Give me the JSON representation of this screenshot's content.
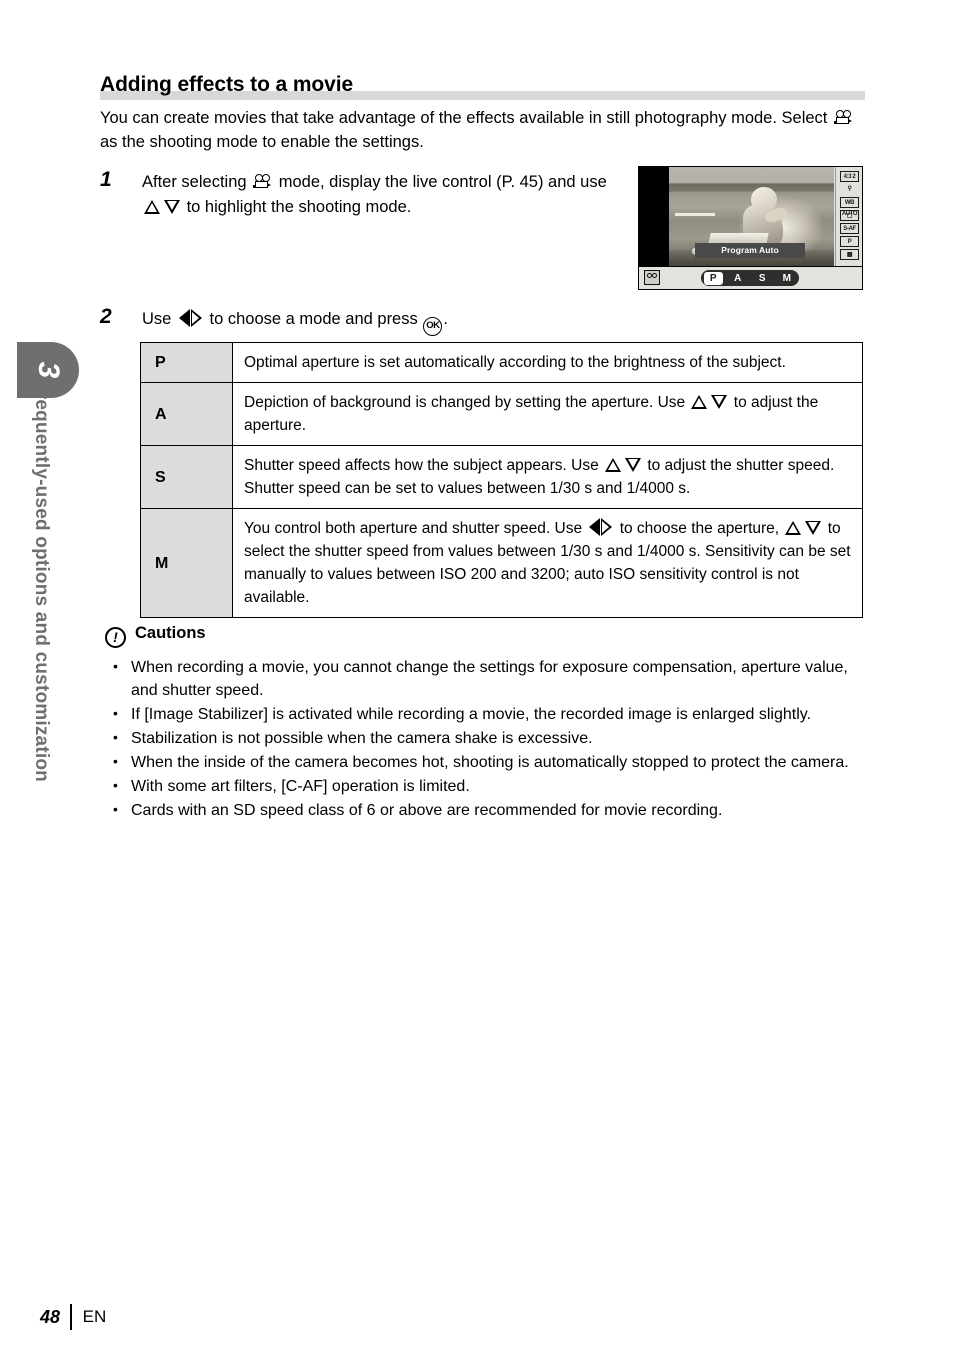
{
  "chapter": {
    "number": "3",
    "title": "Frequently-used options and customization"
  },
  "section": {
    "heading": "Adding effects to a movie",
    "intro_part1": "You can create movies that take advantage of the effects available in still photography mode. Select ",
    "intro_part2": " as the shooting mode to enable the settings."
  },
  "steps": [
    {
      "number": "1",
      "text_a": "After selecting ",
      "text_b": " mode, display the live control (P. 45) and use ",
      "text_c": " to highlight the shooting mode."
    },
    {
      "number": "2",
      "text_a": "Use ",
      "text_b": " to choose a mode and press ",
      "text_c": "."
    }
  ],
  "lcd": {
    "mode_label": "Program Auto",
    "mode_strip": [
      {
        "label": "P",
        "selected": true
      },
      {
        "label": "A",
        "selected": false
      },
      {
        "label": "S",
        "selected": false
      },
      {
        "label": "M",
        "selected": false
      }
    ],
    "side_icons": [
      {
        "name": "image-aspect-icon",
        "label": "4:3 2"
      },
      {
        "name": "art-filter-icon",
        "label": ""
      },
      {
        "name": "white-balance-auto-icon",
        "label": "WB AUTO"
      },
      {
        "name": "drive-mode-icon",
        "label": ""
      },
      {
        "name": "af-mode-icon",
        "label": "S-AF"
      },
      {
        "name": "shooting-mode-icon",
        "label": "P"
      },
      {
        "name": "image-quality-icon",
        "label": ""
      }
    ]
  },
  "mode_table": {
    "rows": [
      {
        "key": "P",
        "desc": "Optimal aperture is set automatically according to the brightness of the subject."
      },
      {
        "key": "A",
        "desc_a": "Depiction of background is changed by setting the aperture. Use ",
        "desc_b": " to adjust the aperture."
      },
      {
        "key": "S",
        "desc_a": "Shutter speed affects how the subject appears. Use ",
        "desc_b": " to adjust the shutter speed. Shutter speed can be set to values between 1/30 s and 1/4000 s."
      },
      {
        "key": "M",
        "desc_a": "You control both aperture and shutter speed. Use ",
        "desc_b": " to choose the aperture, ",
        "desc_c": " to select the shutter speed from values between 1/30 s and 1/4000 s. Sensitivity can be set manually to values between ISO 200 and 3200; auto ISO sensitivity control is not available."
      }
    ]
  },
  "cautions": {
    "heading": "Cautions",
    "items": [
      "When recording a movie, you cannot change the settings for exposure compensation, aperture value, and shutter speed.",
      "If [Image Stabilizer] is activated while recording a movie, the recorded image is enlarged slightly.",
      "Stabilization is not possible when the camera shake is excessive.",
      "When the inside of the camera becomes hot, shooting is automatically stopped to protect the camera.",
      "With some art filters, [C-AF] operation is limited.",
      "Cards with an SD speed class of 6 or above are recommended for movie recording."
    ]
  },
  "footer": {
    "page_number": "48",
    "language": "EN"
  }
}
